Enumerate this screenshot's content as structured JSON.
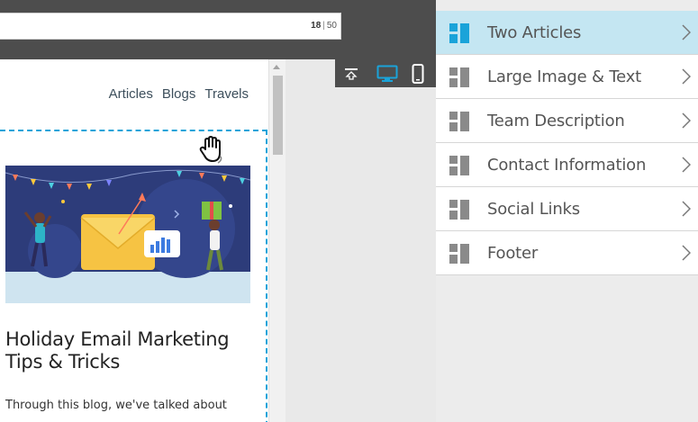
{
  "subject_bar": {
    "char_count_current": "18",
    "char_count_separator": "|",
    "char_count_max": "50"
  },
  "toolbar": {
    "collapse_icon": "collapse-top-icon",
    "desktop_icon": "desktop-icon",
    "mobile_icon": "mobile-icon",
    "active_color": "#1aa3d9"
  },
  "preview": {
    "nav": [
      "Articles",
      "Blogs",
      "Travels"
    ],
    "article": {
      "title": "Holiday Email Marketing Tips & Tricks",
      "excerpt": "Through this blog, we've talked about"
    },
    "selection_color": "#1aa3d9"
  },
  "blocks": {
    "items": [
      {
        "label": "Two Articles",
        "active": true
      },
      {
        "label": "Large Image & Text",
        "active": false
      },
      {
        "label": "Team Description",
        "active": false
      },
      {
        "label": "Contact Information",
        "active": false
      },
      {
        "label": "Social Links",
        "active": false
      },
      {
        "label": "Footer",
        "active": false
      }
    ],
    "active_bg": "#c4e6f2",
    "icon_active_color": "#1aa3d9",
    "icon_color": "#8a8a8a"
  }
}
